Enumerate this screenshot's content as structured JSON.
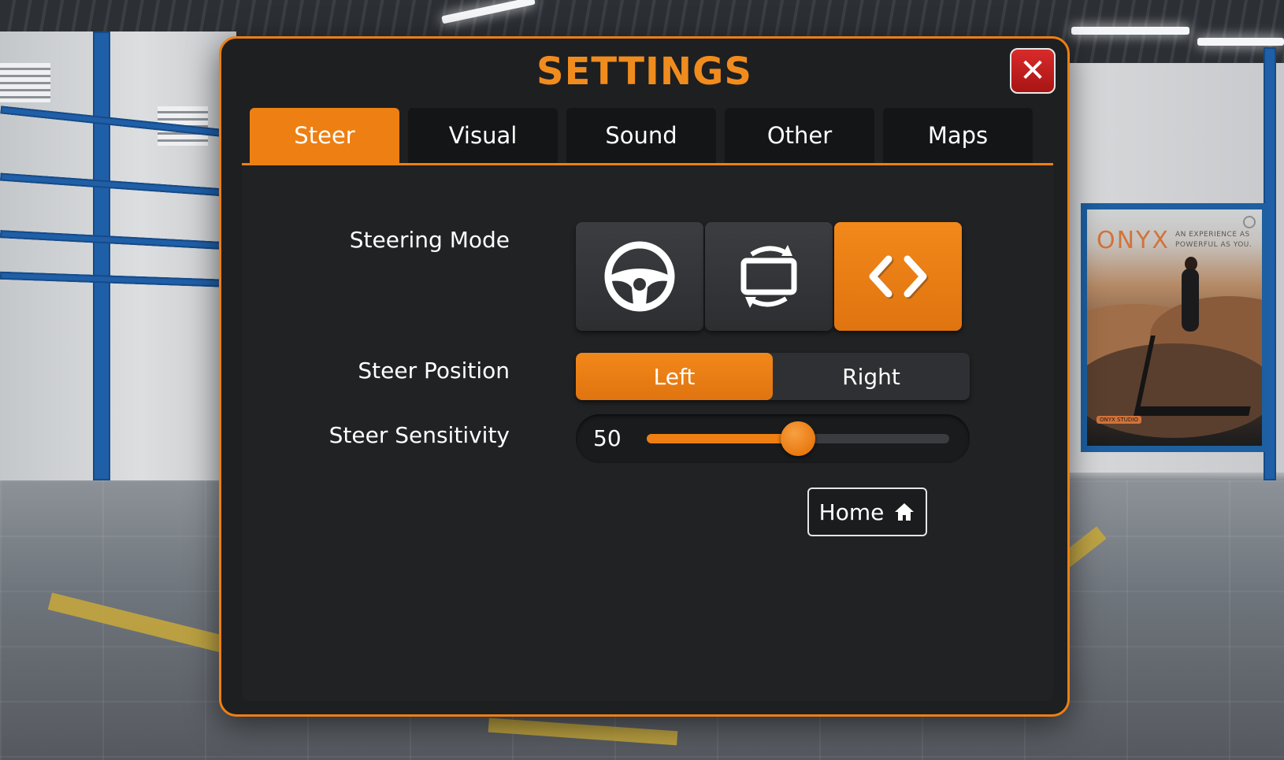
{
  "dialog": {
    "title": "SETTINGS",
    "close_icon": "close-icon",
    "accent_color": "#ee7f12",
    "close_color": "#c21f1f"
  },
  "tabs": [
    {
      "label": "Steer",
      "active": true
    },
    {
      "label": "Visual",
      "active": false
    },
    {
      "label": "Sound",
      "active": false
    },
    {
      "label": "Other",
      "active": false
    },
    {
      "label": "Maps",
      "active": false
    }
  ],
  "steer": {
    "steering_mode": {
      "label": "Steering Mode",
      "options": [
        {
          "icon": "steering-wheel-icon",
          "active": false
        },
        {
          "icon": "rotate-screen-icon",
          "active": false
        },
        {
          "icon": "left-right-arrows-icon",
          "active": true
        }
      ]
    },
    "steer_position": {
      "label": "Steer Position",
      "options": [
        {
          "label": "Left",
          "active": true
        },
        {
          "label": "Right",
          "active": false
        }
      ]
    },
    "steer_sensitivity": {
      "label": "Steer Sensitivity",
      "value": "50",
      "fraction": 0.5
    },
    "home_button": {
      "label": "Home",
      "icon": "home-icon"
    }
  },
  "background": {
    "poster": {
      "brand": "ONYX",
      "tagline": "AN EXPERIENCE AS POWERFUL AS YOU.",
      "badge": "ONYX STUDIO"
    }
  }
}
